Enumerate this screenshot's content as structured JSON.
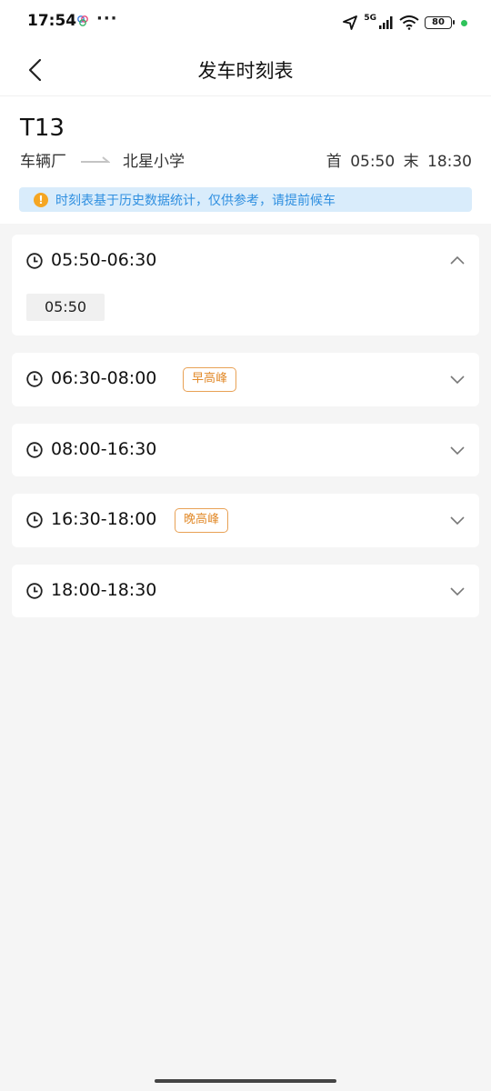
{
  "status_bar": {
    "time": "17:54",
    "network": "5G",
    "battery": "80"
  },
  "nav": {
    "title": "发车时刻表"
  },
  "route": {
    "number": "T13",
    "from": "车辆厂",
    "to": "北星小学",
    "first_label": "首",
    "first_time": "05:50",
    "last_label": "末",
    "last_time": "18:30",
    "notice": "时刻表基于历史数据统计，仅供参考，请提前候车"
  },
  "periods": [
    {
      "range": "05:50-06:30",
      "expanded": true,
      "times": [
        "05:50"
      ]
    },
    {
      "range": "06:30-08:00",
      "badge": "早高峰",
      "expanded": false
    },
    {
      "range": "08:00-16:30",
      "expanded": false
    },
    {
      "range": "16:30-18:00",
      "badge": "晚高峰",
      "expanded": false
    },
    {
      "range": "18:00-18:30",
      "expanded": false
    }
  ],
  "colors": {
    "accent_blue": "#2f8fe0",
    "notice_bg": "#d9ecfb",
    "peak_orange": "#e28b2c",
    "warning": "#f5a623"
  }
}
